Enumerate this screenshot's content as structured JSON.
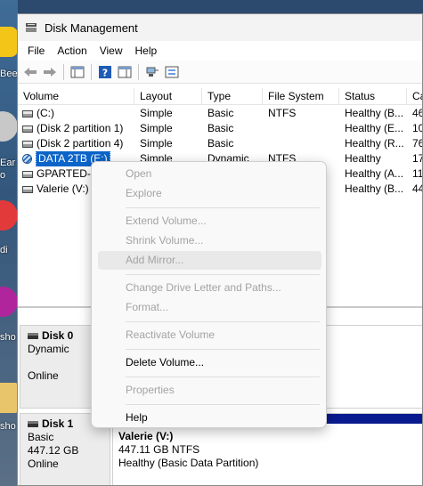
{
  "desktop": {
    "labels": [
      "Bee",
      "Ear",
      "o",
      "di",
      "sho",
      "sho"
    ]
  },
  "window": {
    "title": "Disk Management",
    "menu": [
      "File",
      "Action",
      "View",
      "Help"
    ]
  },
  "columns": [
    "Volume",
    "Layout",
    "Type",
    "File System",
    "Status",
    "Ca"
  ],
  "volumes": [
    {
      "name": "(C:)",
      "layout": "Simple",
      "type": "Basic",
      "fs": "NTFS",
      "status": "Healthy (B...",
      "cap": "46"
    },
    {
      "name": "(Disk 2 partition 1)",
      "layout": "Simple",
      "type": "Basic",
      "fs": "",
      "status": "Healthy (E...",
      "cap": "10"
    },
    {
      "name": "(Disk 2 partition 4)",
      "layout": "Simple",
      "type": "Basic",
      "fs": "",
      "status": "Healthy (R...",
      "cap": "76"
    },
    {
      "name": "DATA 2TB (E:)",
      "layout": "Simple",
      "type": "Dynamic",
      "fs": "NTFS",
      "status": "Healthy",
      "cap": "17"
    },
    {
      "name": "GPARTED-L",
      "layout": "",
      "type": "",
      "fs": "",
      "status": "Healthy (A...",
      "cap": "11"
    },
    {
      "name": "Valerie (V:)",
      "layout": "",
      "type": "",
      "fs": "",
      "status": "Healthy (B...",
      "cap": "44"
    }
  ],
  "disks": [
    {
      "name": "Disk 0",
      "type": "Dynamic",
      "state": "Online"
    },
    {
      "name": "Disk 1",
      "type": "Basic",
      "size": "447.12 GB",
      "state": "Online",
      "partition": {
        "name": "Valerie  (V:)",
        "size": "447.11 GB NTFS",
        "status": "Healthy (Basic Data Partition)"
      }
    }
  ],
  "context_menu": {
    "items": [
      {
        "label": "Open",
        "enabled": false
      },
      {
        "label": "Explore",
        "enabled": false
      },
      {
        "label": "Extend Volume...",
        "enabled": false
      },
      {
        "label": "Shrink Volume...",
        "enabled": false
      },
      {
        "label": "Add Mirror...",
        "enabled": false
      },
      {
        "label": "Change Drive Letter and Paths...",
        "enabled": false
      },
      {
        "label": "Format...",
        "enabled": false
      },
      {
        "label": "Reactivate Volume",
        "enabled": false
      },
      {
        "label": "Delete Volume...",
        "enabled": true
      },
      {
        "label": "Properties",
        "enabled": false
      },
      {
        "label": "Help",
        "enabled": true
      }
    ]
  }
}
